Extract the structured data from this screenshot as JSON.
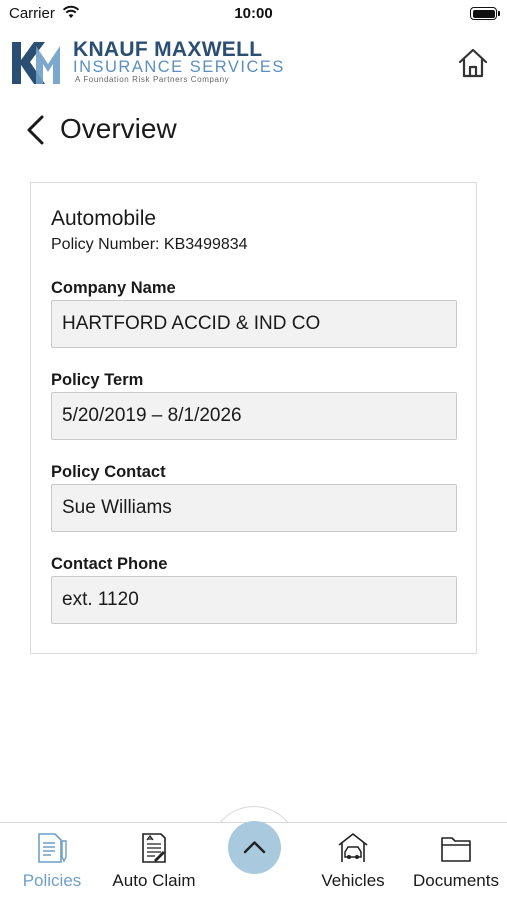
{
  "status": {
    "carrier": "Carrier",
    "time": "10:00"
  },
  "brand": {
    "name": "KNAUF MAXWELL",
    "subtitle": "INSURANCE SERVICES",
    "tagline": "A Foundation Risk Partners Company",
    "colors": {
      "primary": "#2a4f72",
      "secondary": "#5b8fc2",
      "accent": "#6e9fc9"
    }
  },
  "header": {
    "home_icon": "home-icon"
  },
  "page": {
    "title": "Overview",
    "back_icon": "chevron-left-icon"
  },
  "policy": {
    "type": "Automobile",
    "number": "Policy Number: KB3499834",
    "fields": [
      {
        "label": "Company Name",
        "value": "HARTFORD ACCID & IND CO"
      },
      {
        "label": "Policy Term",
        "value": "5/20/2019 – 8/1/2026"
      },
      {
        "label": "Policy Contact",
        "value": "Sue Williams"
      },
      {
        "label": "Contact Phone",
        "value": "ext. 1120"
      }
    ]
  },
  "tabs": [
    {
      "label": "Policies",
      "icon": "policy-document-icon",
      "active": true
    },
    {
      "label": "Auto Claim",
      "icon": "claim-form-icon",
      "active": false
    },
    {
      "label": "Vehicles",
      "icon": "car-garage-icon",
      "active": false
    },
    {
      "label": "Documents",
      "icon": "folder-icon",
      "active": false
    }
  ],
  "center_action": {
    "icon": "chevron-up-icon"
  }
}
